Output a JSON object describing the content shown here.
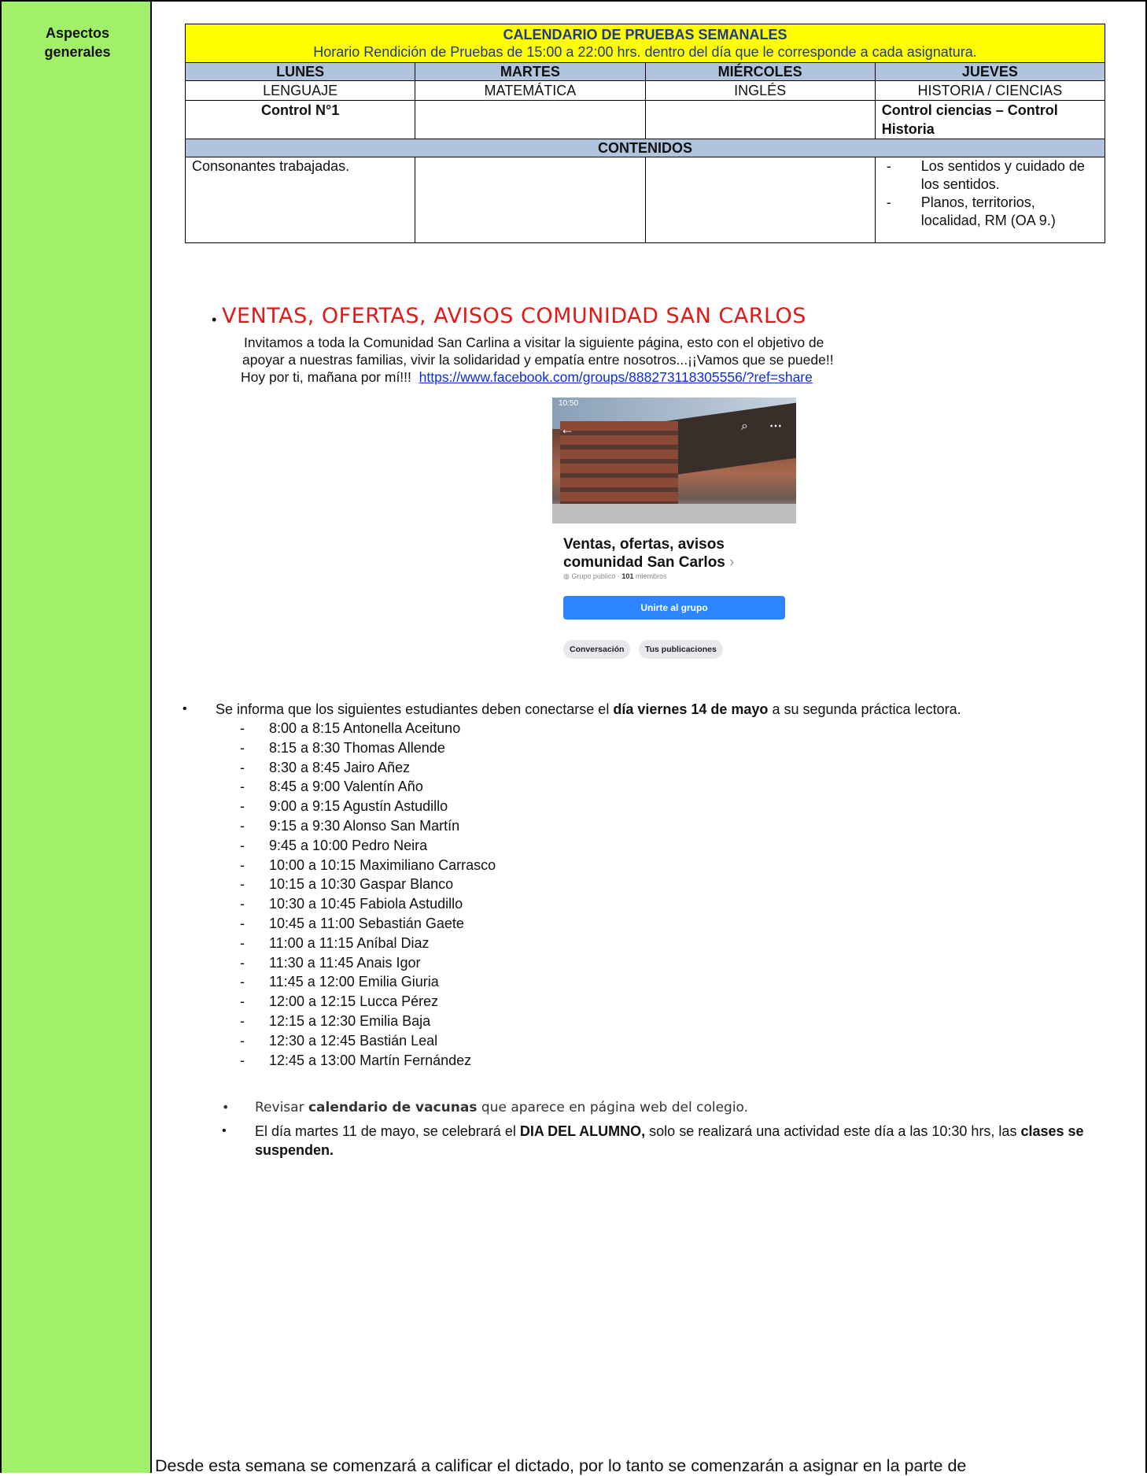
{
  "sidebar": {
    "label_line1": "Aspectos",
    "label_line2": "generales"
  },
  "calendar": {
    "title": "CALENDARIO DE PRUEBAS SEMANALES",
    "subtitle": "Horario Rendición de Pruebas de 15:00 a 22:00 hrs. dentro del día que le corresponde a cada asignatura.",
    "days": [
      "LUNES",
      "MARTES",
      "MIÉRCOLES",
      "JUEVES"
    ],
    "subjects": [
      "LENGUAJE",
      "MATEMÁTICA",
      "INGLÉS",
      "HISTORIA / CIENCIAS"
    ],
    "controls": [
      "Control N°1",
      "",
      "",
      "Control ciencias – Control Historia"
    ],
    "contents_header": "CONTENIDOS",
    "contents_lunes": "Consonantes trabajadas.",
    "contents_jueves": [
      "Los sentidos y cuidado de los sentidos.",
      "Planos, territorios, localidad, RM (OA 9.)"
    ]
  },
  "community": {
    "title": "VENTAS, OFERTAS, AVISOS COMUNIDAD SAN CARLOS",
    "line1": "Invitamos a toda la Comunidad San Carlina a visitar la siguiente página, esto con el objetivo de",
    "line2": "apoyar a nuestras familias, vivir la solidaridad y empatía entre nosotros...¡¡Vamos que se puede!!",
    "line3": "Hoy por ti, mañana por mí!!!",
    "link": "https://www.facebook.com/groups/888273118305556/?ref=share",
    "fb": {
      "status_time": "10:50",
      "group_name": "Ventas, ofertas, avisos comunidad San Carlos",
      "meta_prefix": "Grupo público · ",
      "meta_count": "101",
      "meta_suffix": " miembros",
      "join_label": "Unirte al grupo",
      "chip1": "Conversación",
      "chip2": "Tus publicaciones"
    }
  },
  "practice": {
    "intro_pre": "Se informa que los siguientes estudiantes deben conectarse el ",
    "intro_bold": "día viernes 14 de mayo",
    "intro_post": " a su segunda práctica lectora.",
    "slots": [
      "8:00 a 8:15 Antonella Aceituno",
      "8:15 a 8:30 Thomas Allende",
      "8:30 a 8:45 Jairo Añez",
      "8:45 a 9:00 Valentín Año",
      "9:00 a 9:15 Agustín Astudillo",
      "9:15 a 9:30 Alonso San Martín",
      "9:45 a 10:00 Pedro Neira",
      "10:00 a 10:15 Maximiliano Carrasco",
      "10:15 a 10:30 Gaspar Blanco",
      "10:30 a 10:45 Fabiola Astudillo",
      "10:45 a 11:00 Sebastián Gaete",
      "11:00 a 11:15 Aníbal Diaz",
      "11:30 a 11:45 Anais Igor",
      "11:45 a 12:00 Emilia Giuria",
      "12:00 a 12:15 Lucca Pérez",
      "12:15 a 12:30 Emilia Baja",
      "12:30 a 12:45 Bastián Leal",
      "12:45 a 13:00 Martín Fernández"
    ]
  },
  "notices": {
    "vac_pre": "Revisar ",
    "vac_bold": "calendario de vacunas",
    "vac_post": " que aparece en página web del colegio.",
    "alumno_pre": "El día martes 11 de mayo, se celebrará el ",
    "alumno_bold": "DIA DEL ALUMNO,",
    "alumno_mid": " solo se realizará una actividad este día a las 10:30 hrs, las ",
    "alumno_bold2": "clases se suspenden."
  },
  "footer": {
    "text": "Desde esta semana se comenzará a calificar el dictado, por lo tanto se comenzarán a asignar en la parte de"
  }
}
